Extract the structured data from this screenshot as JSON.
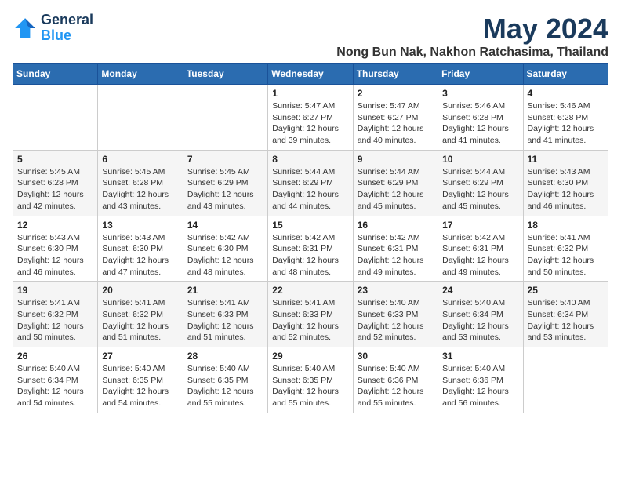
{
  "header": {
    "logo_line1": "General",
    "logo_line2": "Blue",
    "month": "May 2024",
    "location": "Nong Bun Nak, Nakhon Ratchasima, Thailand"
  },
  "weekdays": [
    "Sunday",
    "Monday",
    "Tuesday",
    "Wednesday",
    "Thursday",
    "Friday",
    "Saturday"
  ],
  "weeks": [
    [
      {
        "day": "",
        "info": ""
      },
      {
        "day": "",
        "info": ""
      },
      {
        "day": "",
        "info": ""
      },
      {
        "day": "1",
        "info": "Sunrise: 5:47 AM\nSunset: 6:27 PM\nDaylight: 12 hours\nand 39 minutes."
      },
      {
        "day": "2",
        "info": "Sunrise: 5:47 AM\nSunset: 6:27 PM\nDaylight: 12 hours\nand 40 minutes."
      },
      {
        "day": "3",
        "info": "Sunrise: 5:46 AM\nSunset: 6:28 PM\nDaylight: 12 hours\nand 41 minutes."
      },
      {
        "day": "4",
        "info": "Sunrise: 5:46 AM\nSunset: 6:28 PM\nDaylight: 12 hours\nand 41 minutes."
      }
    ],
    [
      {
        "day": "5",
        "info": "Sunrise: 5:45 AM\nSunset: 6:28 PM\nDaylight: 12 hours\nand 42 minutes."
      },
      {
        "day": "6",
        "info": "Sunrise: 5:45 AM\nSunset: 6:28 PM\nDaylight: 12 hours\nand 43 minutes."
      },
      {
        "day": "7",
        "info": "Sunrise: 5:45 AM\nSunset: 6:29 PM\nDaylight: 12 hours\nand 43 minutes."
      },
      {
        "day": "8",
        "info": "Sunrise: 5:44 AM\nSunset: 6:29 PM\nDaylight: 12 hours\nand 44 minutes."
      },
      {
        "day": "9",
        "info": "Sunrise: 5:44 AM\nSunset: 6:29 PM\nDaylight: 12 hours\nand 45 minutes."
      },
      {
        "day": "10",
        "info": "Sunrise: 5:44 AM\nSunset: 6:29 PM\nDaylight: 12 hours\nand 45 minutes."
      },
      {
        "day": "11",
        "info": "Sunrise: 5:43 AM\nSunset: 6:30 PM\nDaylight: 12 hours\nand 46 minutes."
      }
    ],
    [
      {
        "day": "12",
        "info": "Sunrise: 5:43 AM\nSunset: 6:30 PM\nDaylight: 12 hours\nand 46 minutes."
      },
      {
        "day": "13",
        "info": "Sunrise: 5:43 AM\nSunset: 6:30 PM\nDaylight: 12 hours\nand 47 minutes."
      },
      {
        "day": "14",
        "info": "Sunrise: 5:42 AM\nSunset: 6:30 PM\nDaylight: 12 hours\nand 48 minutes."
      },
      {
        "day": "15",
        "info": "Sunrise: 5:42 AM\nSunset: 6:31 PM\nDaylight: 12 hours\nand 48 minutes."
      },
      {
        "day": "16",
        "info": "Sunrise: 5:42 AM\nSunset: 6:31 PM\nDaylight: 12 hours\nand 49 minutes."
      },
      {
        "day": "17",
        "info": "Sunrise: 5:42 AM\nSunset: 6:31 PM\nDaylight: 12 hours\nand 49 minutes."
      },
      {
        "day": "18",
        "info": "Sunrise: 5:41 AM\nSunset: 6:32 PM\nDaylight: 12 hours\nand 50 minutes."
      }
    ],
    [
      {
        "day": "19",
        "info": "Sunrise: 5:41 AM\nSunset: 6:32 PM\nDaylight: 12 hours\nand 50 minutes."
      },
      {
        "day": "20",
        "info": "Sunrise: 5:41 AM\nSunset: 6:32 PM\nDaylight: 12 hours\nand 51 minutes."
      },
      {
        "day": "21",
        "info": "Sunrise: 5:41 AM\nSunset: 6:33 PM\nDaylight: 12 hours\nand 51 minutes."
      },
      {
        "day": "22",
        "info": "Sunrise: 5:41 AM\nSunset: 6:33 PM\nDaylight: 12 hours\nand 52 minutes."
      },
      {
        "day": "23",
        "info": "Sunrise: 5:40 AM\nSunset: 6:33 PM\nDaylight: 12 hours\nand 52 minutes."
      },
      {
        "day": "24",
        "info": "Sunrise: 5:40 AM\nSunset: 6:34 PM\nDaylight: 12 hours\nand 53 minutes."
      },
      {
        "day": "25",
        "info": "Sunrise: 5:40 AM\nSunset: 6:34 PM\nDaylight: 12 hours\nand 53 minutes."
      }
    ],
    [
      {
        "day": "26",
        "info": "Sunrise: 5:40 AM\nSunset: 6:34 PM\nDaylight: 12 hours\nand 54 minutes."
      },
      {
        "day": "27",
        "info": "Sunrise: 5:40 AM\nSunset: 6:35 PM\nDaylight: 12 hours\nand 54 minutes."
      },
      {
        "day": "28",
        "info": "Sunrise: 5:40 AM\nSunset: 6:35 PM\nDaylight: 12 hours\nand 55 minutes."
      },
      {
        "day": "29",
        "info": "Sunrise: 5:40 AM\nSunset: 6:35 PM\nDaylight: 12 hours\nand 55 minutes."
      },
      {
        "day": "30",
        "info": "Sunrise: 5:40 AM\nSunset: 6:36 PM\nDaylight: 12 hours\nand 55 minutes."
      },
      {
        "day": "31",
        "info": "Sunrise: 5:40 AM\nSunset: 6:36 PM\nDaylight: 12 hours\nand 56 minutes."
      },
      {
        "day": "",
        "info": ""
      }
    ]
  ]
}
